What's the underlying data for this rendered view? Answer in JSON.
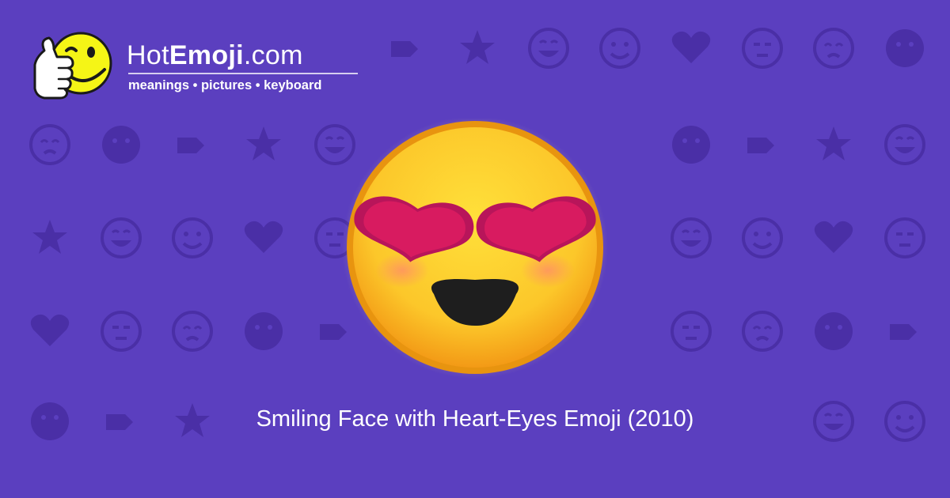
{
  "brand": {
    "name_part1": "Hot",
    "name_part2": "Emoji",
    "name_part3": ".com",
    "tagline": "meanings • pictures • keyboard"
  },
  "caption": "Smiling Face with Heart-Eyes Emoji (2010)",
  "colors": {
    "background": "#5b3fbf",
    "pattern": "#4a2fa6",
    "emoji_face": "#fbc531",
    "emoji_heart": "#d81b60",
    "mascot": "#f5f516"
  },
  "background_icons": [
    "smiley-icon",
    "heart-icon",
    "wink-icon",
    "kiss-icon",
    "hearts-icon",
    "sad-icon",
    "tired-icon",
    "ok-hand-icon",
    "neutral-icon",
    "eyes-icon",
    "smirk-icon",
    "recycle-icon",
    "raised-hands-icon",
    "music-notes-icon",
    "sleeping-icon",
    "sparkles-icon",
    "grin-icon",
    "broken-heart-icon",
    "confused-icon",
    "tongue-icon",
    "frown-icon",
    "monkey-icon",
    "scream-icon",
    "devil-icon",
    "angry-icon",
    "left-arrow-icon",
    "fire-icon",
    "party-popper-icon",
    "rose-icon",
    "sun-icon",
    "muscle-icon",
    "check-icon",
    "cat-face-icon",
    "hand-icon",
    "mask-icon",
    "camera-icon"
  ],
  "hero": {
    "icon": "smiling-face-with-heart-eyes-icon"
  }
}
